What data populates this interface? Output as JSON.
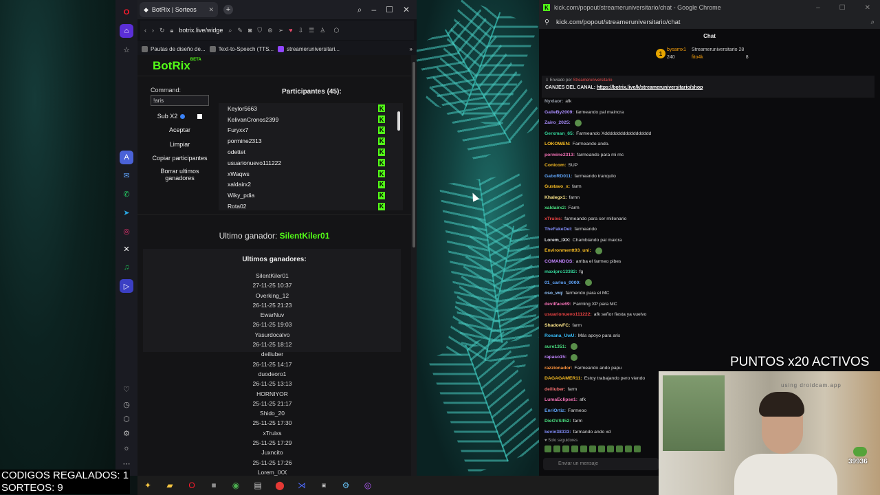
{
  "browser": {
    "tab_title": "BotRix | Sorteos",
    "url": "botrix.live/widge",
    "bookmarks": [
      "Pautas de diseño de...",
      "Text-to-Speech (TTS...",
      "streameruniversitari..."
    ]
  },
  "botrix": {
    "logo": "BotRix",
    "logo_sup": "BETA",
    "command_label": "Command:",
    "command_value": "!aris",
    "sub_label": "Sub X2",
    "buttons": {
      "accept": "Aceptar",
      "clear": "Limpiar",
      "copy": "Copiar participantes",
      "delete": "Borrar ultimos ganadores"
    },
    "participants_title": "Participantes (45):",
    "participants": [
      "Keylor5663",
      "KelivanCronos2399",
      "Furyxx7",
      "pormine2313",
      "odettet",
      "usuarionuevo111222",
      "xWaqws",
      "xaldairx2",
      "Wiky_pdia",
      "Rota02"
    ],
    "last_winner_label": "Ultimo ganador:",
    "last_winner": "SilentKiler01",
    "winners_title": "Ultimos ganadores:",
    "winners": [
      "SilentKiler01",
      "27-11-25 10:37",
      "Overking_12",
      "26-11-25 21:23",
      "EwarNuv",
      "26-11-25 19:03",
      "Yasurdocalvo",
      "26-11-25 18:12",
      "deiliuber",
      "26-11-25 14:17",
      "duodeoro1",
      "26-11-25 13:13",
      "HORNIYOR",
      "25-11-25 21:17",
      "Shido_20",
      "25-11-25 17:30",
      "xTruixs",
      "25-11-25 17:29",
      "Juxncito",
      "25-11-25 17:26",
      "Lorem_IXX"
    ]
  },
  "chrome": {
    "title": "kick.com/popout/streameruniversitario/chat - Google Chrome",
    "url": "kick.com/popout/streameruniversitario/chat",
    "chat_header": "Chat",
    "leader": {
      "rank": "1",
      "user1": "bysamx1",
      "user1_val": "240",
      "user2": "Streameruniversitario",
      "user2_val": "28",
      "user3": "fito4k",
      "user3_val": "8"
    },
    "pinned_sub_label": "Enviado por",
    "pinned_sub_user": "Streameruniversitario",
    "pinned_text": "CANJES DEL CANAL:",
    "pinned_link": "https://botrix.live/k/streameruniversitario/shop",
    "messages": [
      {
        "user": "Nyxlaor:",
        "text": "afk",
        "color": "#9ca3af"
      },
      {
        "user": "GalleBy2009:",
        "text": "farmeando pal maincra",
        "color": "#a78bfa"
      },
      {
        "user": "Zairo_2025:",
        "text": "",
        "color": "#a78bfa"
      },
      {
        "user": "Gerxman_65:",
        "text": "Farmeando Xdddddddddddddddddd",
        "color": "#34d399"
      },
      {
        "user": "LOKOWEN:",
        "text": "Farmeando ando.",
        "color": "#fbbf24"
      },
      {
        "user": "pormine2313:",
        "text": "farmeando para mi mc",
        "color": "#f472b6"
      },
      {
        "user": "Conicom:",
        "text": "SUP",
        "color": "#fbbf24"
      },
      {
        "user": "GaboRD011:",
        "text": "farmeando tranquilo",
        "color": "#60a5fa"
      },
      {
        "user": "Gustavo_x:",
        "text": "farm",
        "color": "#fbbf24"
      },
      {
        "user": "Khalegx1:",
        "text": "farnn",
        "color": "#fde68a"
      },
      {
        "user": "xaldairx2:",
        "text": "Farm",
        "color": "#4ade80"
      },
      {
        "user": "xTruixs:",
        "text": "farmeando para ser millonario",
        "color": "#ef4444"
      },
      {
        "user": "TheFakeDel:",
        "text": "farmeando",
        "color": "#818cf8"
      },
      {
        "user": "Lorem_IXX:",
        "text": "Chambiando pal maicra",
        "color": "#e5e7eb"
      },
      {
        "user": "Environmentt03_uni:",
        "text": "",
        "color": "#fbbf24"
      },
      {
        "user": "COMANDOS:",
        "text": "arriba el farmeo pibes",
        "color": "#c084fc"
      },
      {
        "user": "maxipro13382:",
        "text": "fg",
        "color": "#34d399"
      },
      {
        "user": "01_carlos_0000:",
        "text": "",
        "color": "#60a5fa"
      },
      {
        "user": "oso_wq:",
        "text": "farmendo para el MC",
        "color": "#93c5fd"
      },
      {
        "user": "devilface69:",
        "text": "Farming XP para MC",
        "color": "#f472b6"
      },
      {
        "user": "usuarionuevo111222:",
        "text": "afk señor fiesta ya vuelvo",
        "color": "#ef4444"
      },
      {
        "user": "ShadowFC:",
        "text": "farm",
        "color": "#fde68a"
      },
      {
        "user": "Roxana_UwU:",
        "text": "Más apoyo para aris",
        "color": "#38bdf8"
      },
      {
        "user": "sure1351:",
        "text": "",
        "color": "#4ade80"
      },
      {
        "user": "rapaso15:",
        "text": "",
        "color": "#c084fc"
      },
      {
        "user": "razzionador:",
        "text": "Farmeando ando papu",
        "color": "#fb923c"
      },
      {
        "user": "DAGAGAMER11:",
        "text": "Estoy trabajando pero viendo",
        "color": "#fbbf24"
      },
      {
        "user": "deiliuber:",
        "text": "farm",
        "color": "#f87171"
      },
      {
        "user": "LumaEclipse1:",
        "text": "afk",
        "color": "#f472b6"
      },
      {
        "user": "EnriOrtiz:",
        "text": "Farmeoo",
        "color": "#60a5fa"
      },
      {
        "user": "DieGVS452:",
        "text": "farm",
        "color": "#4ade80"
      },
      {
        "user": "kevin38333:",
        "text": "farmando ando xd",
        "color": "#818cf8"
      }
    ],
    "followers_label": "Solo seguidores",
    "input_placeholder": "Enviar un mensaje"
  },
  "overlay": {
    "puntos": "PUNTOS x20 ACTIVOS",
    "webcam_brand": "using droidcam.app",
    "count": "39936",
    "codes_line1": "CODIGOS REGALADOS: 1",
    "codes_line2": "SORTEOS: 9"
  },
  "colors": {
    "accent": "#53fc18",
    "background": "#141416"
  }
}
